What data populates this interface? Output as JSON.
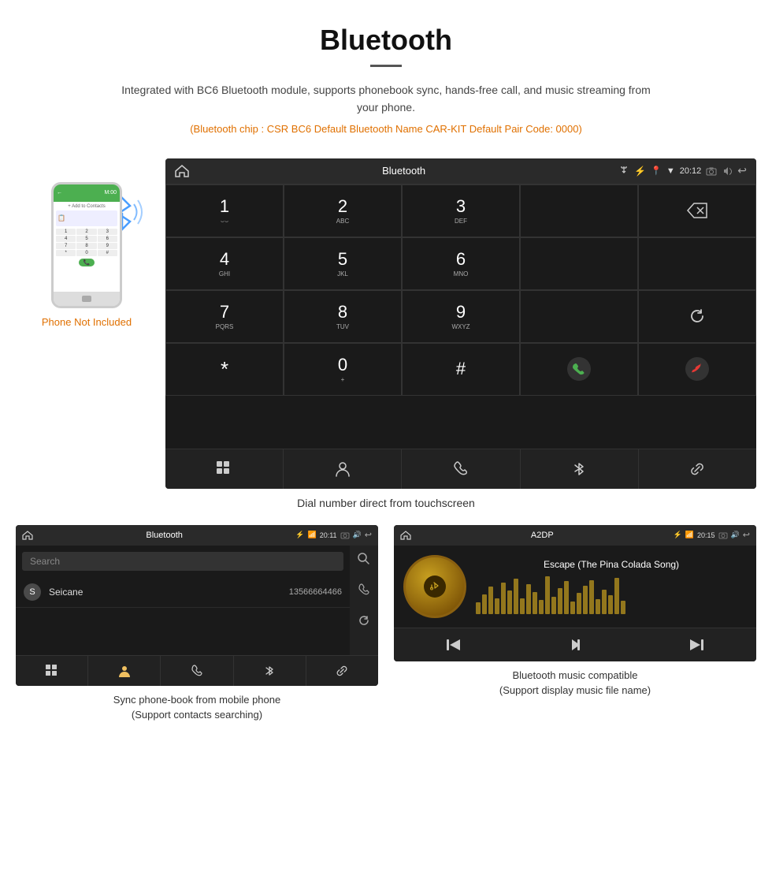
{
  "page": {
    "title": "Bluetooth",
    "description": "Integrated with BC6 Bluetooth module, supports phonebook sync, hands-free call, and music streaming from your phone.",
    "specs": "(Bluetooth chip : CSR BC6    Default Bluetooth Name CAR-KIT    Default Pair Code: 0000)"
  },
  "phone": {
    "not_included_label": "Phone Not Included",
    "top_bar_label": "M:00",
    "contacts_label": "+ Add to Contacts",
    "keys": [
      "1",
      "2",
      "3",
      "4",
      "5",
      "6",
      "7",
      "8",
      "9",
      "*",
      "0",
      "#"
    ]
  },
  "main_screen": {
    "status_bar": {
      "title": "Bluetooth",
      "time": "20:12"
    },
    "dialpad": {
      "keys": [
        {
          "main": "1",
          "sub": "⌣⌣"
        },
        {
          "main": "2",
          "sub": "ABC"
        },
        {
          "main": "3",
          "sub": "DEF"
        },
        {
          "main": "",
          "sub": ""
        },
        {
          "main": "⌫",
          "sub": ""
        },
        {
          "main": "4",
          "sub": "GHI"
        },
        {
          "main": "5",
          "sub": "JKL"
        },
        {
          "main": "6",
          "sub": "MNO"
        },
        {
          "main": "",
          "sub": ""
        },
        {
          "main": "",
          "sub": ""
        },
        {
          "main": "7",
          "sub": "PQRS"
        },
        {
          "main": "8",
          "sub": "TUV"
        },
        {
          "main": "9",
          "sub": "WXYZ"
        },
        {
          "main": "",
          "sub": ""
        },
        {
          "main": "↺",
          "sub": ""
        },
        {
          "main": "*",
          "sub": ""
        },
        {
          "main": "0",
          "sub": "+"
        },
        {
          "main": "#",
          "sub": ""
        },
        {
          "main": "📞",
          "sub": ""
        },
        {
          "main": "📞",
          "sub": "end"
        }
      ]
    },
    "bottom_icons": [
      "grid",
      "person",
      "phone",
      "bluetooth",
      "link"
    ]
  },
  "main_screen_caption": "Dial number direct from touchscreen",
  "phonebook_screen": {
    "status_bar": {
      "title": "Bluetooth",
      "time": "20:11"
    },
    "search_placeholder": "Search",
    "contacts": [
      {
        "letter": "S",
        "name": "Seicane",
        "number": "13566664466"
      }
    ],
    "bottom_icons": [
      "grid",
      "person",
      "phone",
      "bluetooth",
      "link"
    ]
  },
  "phonebook_caption_line1": "Sync phone-book from mobile phone",
  "phonebook_caption_line2": "(Support contacts searching)",
  "music_screen": {
    "status_bar": {
      "title": "A2DP",
      "time": "20:15"
    },
    "song_title": "Escape (The Pina Colada Song)",
    "controls": [
      "⏮",
      "⏯",
      "⏭"
    ]
  },
  "music_caption_line1": "Bluetooth music compatible",
  "music_caption_line2": "(Support display music file name)"
}
